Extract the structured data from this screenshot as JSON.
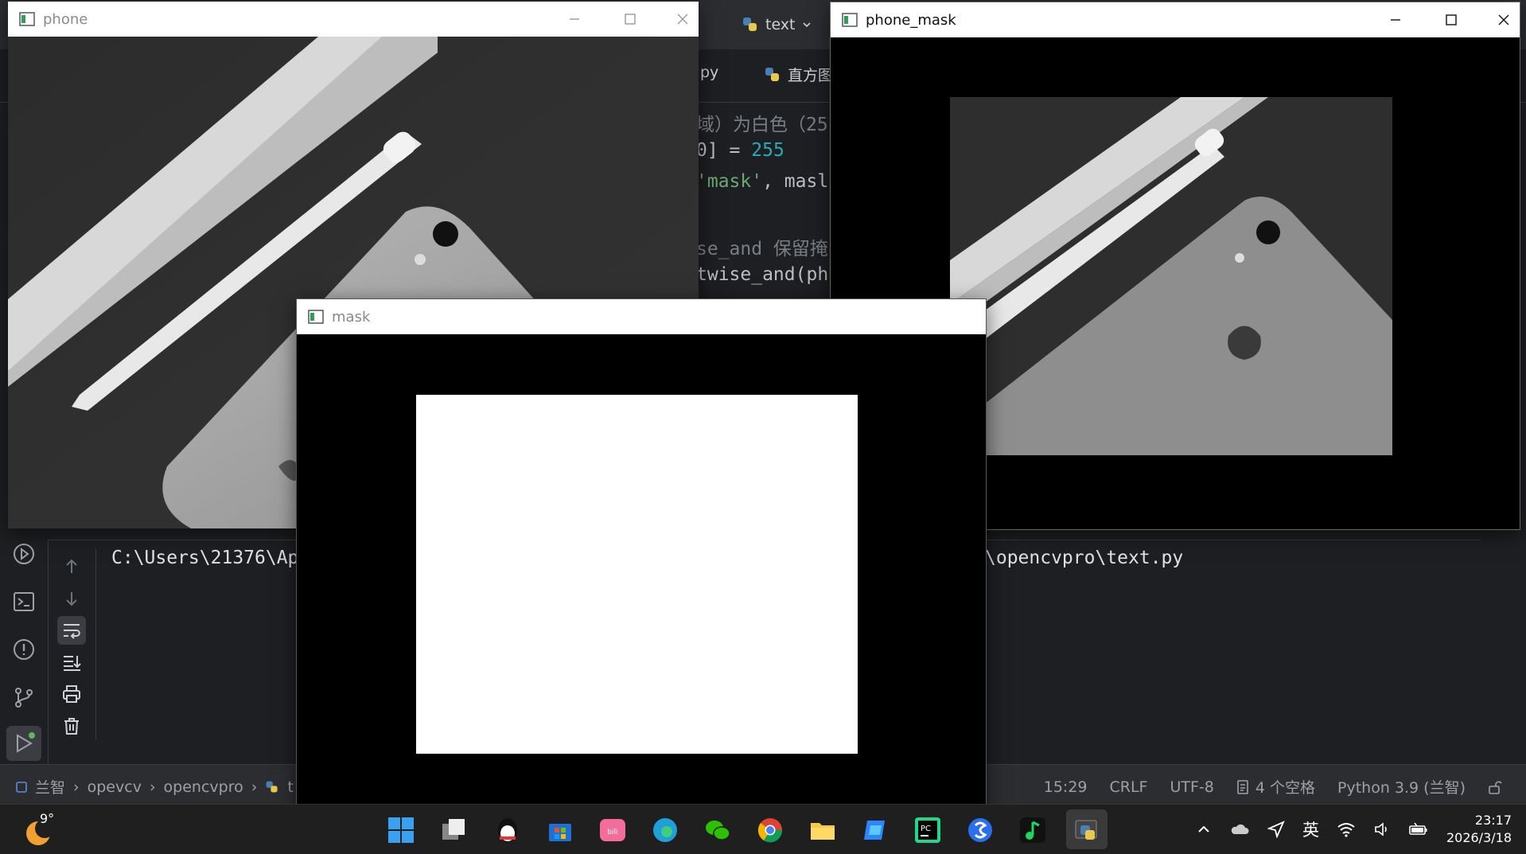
{
  "ide": {
    "project_widget": "text",
    "tabs": [
      {
        "label": "py"
      },
      {
        "label": "直方图"
      }
    ],
    "code": {
      "line1_comment": "域）为白色（25",
      "line2_part": "0] = ",
      "line2_num": "255",
      "line3_str": "'mask'",
      "line3_rest": ", masl",
      "line5_comment": "se_and 保留掩",
      "line6": "twise_and(ph"
    },
    "console": {
      "left_text": "C:\\Users\\21376\\Ap",
      "right_text": "\\opencvpro\\text.py"
    },
    "breadcrumb": [
      "兰智",
      "opevcv",
      "opencvpro",
      "t"
    ],
    "status": {
      "position": "15:29",
      "line_sep": "CRLF",
      "encoding": "UTF-8",
      "indent": "4 个空格",
      "interpreter": "Python 3.9 (兰智)"
    }
  },
  "windows": {
    "phone": {
      "title": "phone"
    },
    "mask": {
      "title": "mask"
    },
    "phone_mask": {
      "title": "phone_mask"
    }
  },
  "taskbar": {
    "weather_temp": "9°",
    "ime": "英",
    "time": "23:17",
    "date": "2026/3/18",
    "apps": [
      "windows-start",
      "task-view",
      "qq",
      "microsoft-store",
      "bilibili",
      "edge",
      "wechat",
      "chrome",
      "file-explorer",
      "copilot",
      "pycharm",
      "sogou",
      "music",
      "python"
    ]
  },
  "colors": {
    "ide_bg": "#1e1f22",
    "panel_bg": "#2b2d30",
    "code_number": "#2aacb8",
    "code_string": "#6aab73",
    "code_comment": "#7a7e85",
    "titlebar_bg": "#ffffff"
  }
}
